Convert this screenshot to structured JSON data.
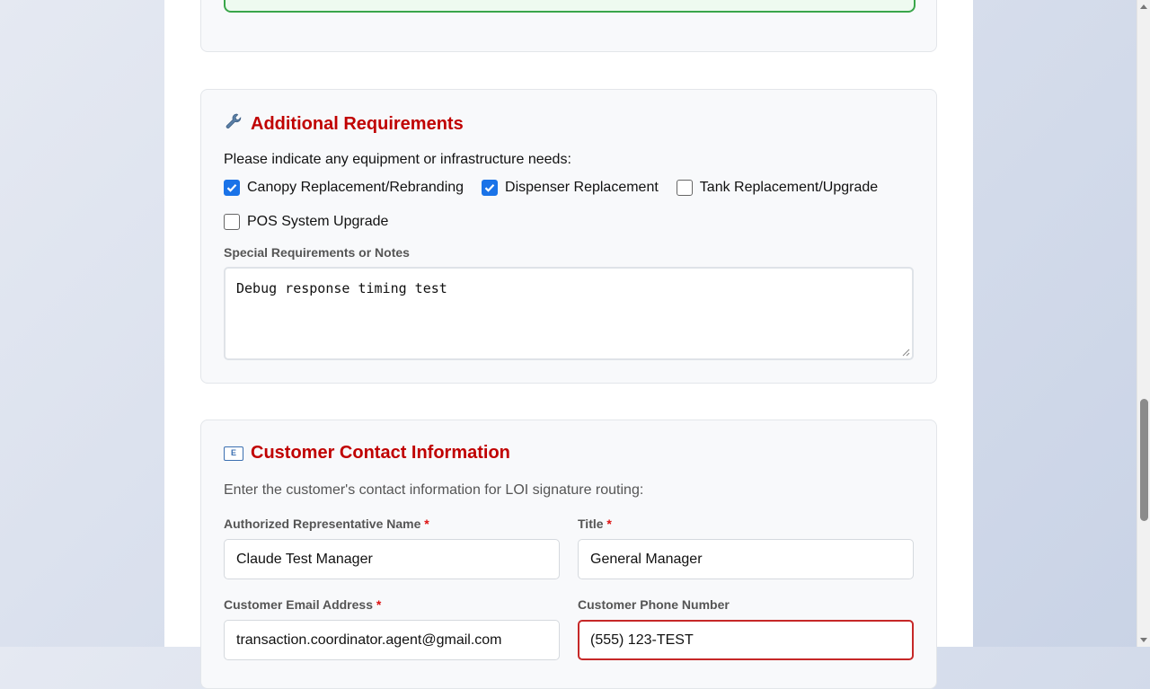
{
  "requirements": {
    "icon": "wrench-icon",
    "title": "Additional Requirements",
    "prompt": "Please indicate any equipment or infrastructure needs:",
    "options": [
      {
        "label": "Canopy Replacement/Rebranding",
        "checked": true
      },
      {
        "label": "Dispenser Replacement",
        "checked": true
      },
      {
        "label": "Tank Replacement/Upgrade",
        "checked": false
      },
      {
        "label": "POS System Upgrade",
        "checked": false
      }
    ],
    "notes_label": "Special Requirements or Notes",
    "notes_value": "Debug response timing test"
  },
  "contact": {
    "icon": "envelope-icon",
    "icon_text": "E",
    "title": "Customer Contact Information",
    "description": "Enter the customer's contact information for LOI signature routing:",
    "required_marker": "*",
    "rep_name_label": "Authorized Representative Name",
    "rep_name_value": "Claude Test Manager",
    "title_label": "Title",
    "title_value": "General Manager",
    "email_label": "Customer Email Address",
    "email_value": "transaction.coordinator.agent@gmail.com",
    "phone_label": "Customer Phone Number",
    "phone_value": "(555) 123-TEST"
  },
  "colors": {
    "heading": "#c00000",
    "checkbox_checked": "#1a73e8",
    "error_border": "#c62828",
    "success_border": "#3aa64a"
  }
}
